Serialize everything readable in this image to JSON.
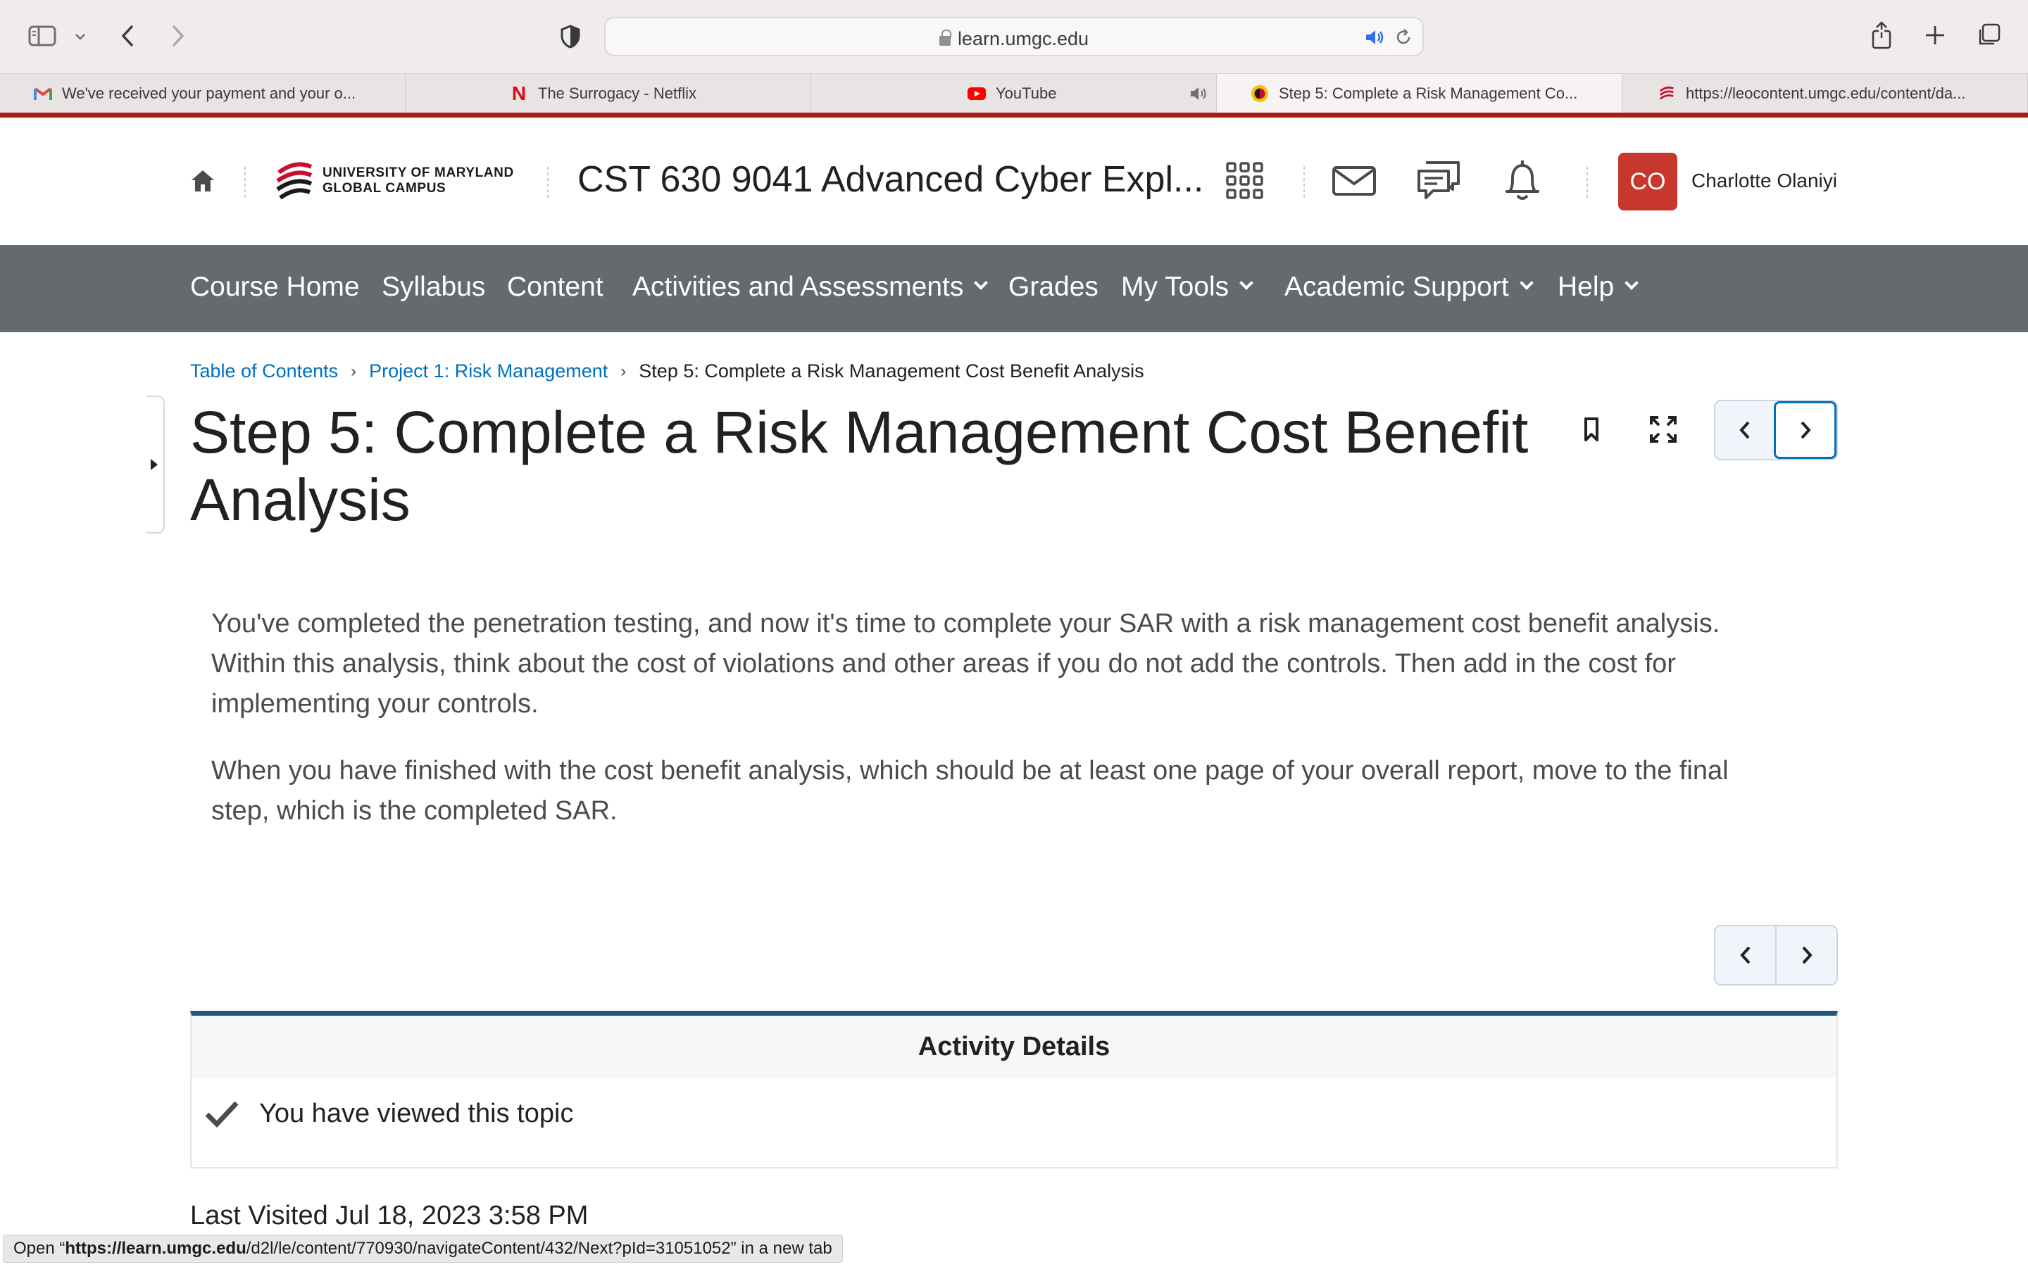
{
  "browser": {
    "address": "learn.umgc.edu",
    "tabs": [
      {
        "label": "We've received your payment and your o...",
        "favicon": "gmail-icon"
      },
      {
        "label": "The Surrogacy - Netflix",
        "favicon": "netflix-icon"
      },
      {
        "label": "YouTube",
        "favicon": "youtube-icon"
      },
      {
        "label": "Step 5: Complete a Risk Management Co...",
        "favicon": "umgc-icon"
      },
      {
        "label": "https://leocontent.umgc.edu/content/da...",
        "favicon": "umgc-icon"
      }
    ],
    "status_prefix": "Open “",
    "status_host": "https://learn.umgc.edu",
    "status_path": "/d2l/le/content/770930/navigateContent/432/Next?pId=31051052”",
    "status_suffix": " in a new tab"
  },
  "header": {
    "logo_line1": "UNIVERSITY OF MARYLAND",
    "logo_line2": "GLOBAL CAMPUS",
    "course_title": "CST 630 9041 Advanced Cyber Expl...",
    "avatar_initials": "CO",
    "user_name": "Charlotte Olaniyi"
  },
  "nav": {
    "items": [
      {
        "label": "Course Home"
      },
      {
        "label": "Syllabus"
      },
      {
        "label": "Content"
      },
      {
        "label": "Activities and Assessments"
      },
      {
        "label": "Grades"
      },
      {
        "label": "My Tools"
      },
      {
        "label": "Academic Support"
      },
      {
        "label": "Help"
      }
    ]
  },
  "breadcrumb": {
    "items": [
      "Table of Contents",
      "Project 1: Risk Management"
    ],
    "current": "Step 5: Complete a Risk Management Cost Benefit Analysis"
  },
  "page": {
    "title": "Step 5: Complete a Risk Management Cost Benefit Analysis",
    "paragraphs": [
      "You've completed the penetration testing, and now it's time to complete your SAR with a risk management cost benefit analysis. Within this analysis, think about the cost of violations and other areas if you do not add the controls. Then add in the cost for implementing your controls.",
      "When you have finished with the cost benefit analysis, which should be at least one page of your overall report, move to the final step, which is the completed SAR."
    ]
  },
  "activity": {
    "heading": "Activity Details",
    "status": "You have viewed this topic"
  },
  "last_visited": "Last Visited Jul 18, 2023 3:58 PM",
  "colors": {
    "brand_red": "#a51c1c",
    "nav_bg": "#656a6e",
    "link": "#006fbf",
    "avatar": "#c8372d",
    "details_accent": "#215a7a"
  }
}
